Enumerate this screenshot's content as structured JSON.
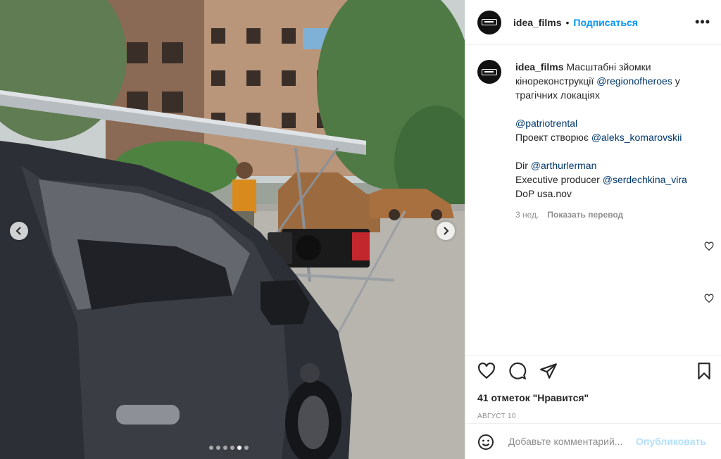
{
  "post": {
    "username": "idea_films",
    "separator": "•",
    "follow_label": "Подписаться",
    "more_label": "•••"
  },
  "caption": {
    "username": "idea_films",
    "line1": "Масштабні зйомки кінореконструкції",
    "mention_region": "@regionofheroes",
    "line1_end": "у трагічних локаціях",
    "mention_patriot": "@patriotrental",
    "project_text": "Проект створює",
    "mention_aleks": "@aleks_komarovskii",
    "dir_text": "Dir",
    "mention_arthur": "@arthurlerman",
    "exec_text": "Executive producer",
    "mention_serdech": "@serdechkina_vira",
    "dop_text": "DoP usa.nov"
  },
  "meta": {
    "age": "3 нед.",
    "translate_label": "Показать перевод"
  },
  "likes_text": "41 отметок \"Нравится\"",
  "date_text": "АВГУСТ 10",
  "comment": {
    "placeholder": "Добавьте комментарий...",
    "publish_label": "Опубликовать"
  },
  "carousel": {
    "total": 6,
    "active_index": 4
  },
  "colors": {
    "link_blue": "#0095f6",
    "mention": "#00376b",
    "muted": "#8e8e8e",
    "publish_disabled": "#b2dffc"
  },
  "icons": [
    "heart-icon",
    "comment-icon",
    "share-icon",
    "bookmark-icon",
    "emoji-icon",
    "chevron-left-icon",
    "chevron-right-icon",
    "more-icon"
  ]
}
